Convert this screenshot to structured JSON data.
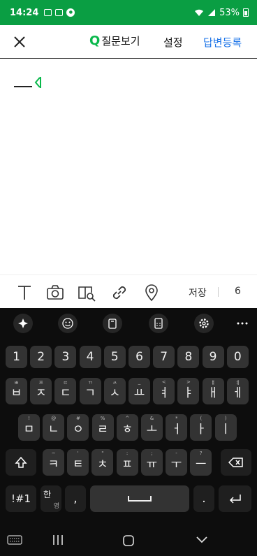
{
  "status": {
    "time": "14:24",
    "battery": "53%"
  },
  "header": {
    "close": "×",
    "q_icon": "Q",
    "q_label": "질문보기",
    "settings": "설정",
    "submit": "답변등록"
  },
  "toolbar": {
    "save": "저장",
    "count": "6"
  },
  "keyboard": {
    "number_row": [
      "1",
      "2",
      "3",
      "4",
      "5",
      "6",
      "7",
      "8",
      "9",
      "0"
    ],
    "row1": {
      "keys": [
        "ㅂ",
        "ㅈ",
        "ㄷ",
        "ㄱ",
        "ㅅ",
        "ㅛ",
        "ㅕ",
        "ㅑ",
        "ㅐ",
        "ㅔ"
      ],
      "hints": [
        "ㅃ",
        "ㅉ",
        "ㄸ",
        "ㄲ",
        "ㅆ",
        "_",
        "<",
        ">",
        "ㅒ",
        "ㅖ"
      ]
    },
    "row2": {
      "keys": [
        "ㅁ",
        "ㄴ",
        "ㅇ",
        "ㄹ",
        "ㅎ",
        "ㅗ",
        "ㅓ",
        "ㅏ",
        "ㅣ"
      ],
      "hints": [
        "!",
        "@",
        "#",
        "%",
        "^",
        "&",
        "*",
        "(",
        ")"
      ]
    },
    "row3": {
      "keys": [
        "ㅋ",
        "ㅌ",
        "ㅊ",
        "ㅍ",
        "ㅠ",
        "ㅜ",
        "ㅡ"
      ],
      "hints": [
        "~",
        "'",
        "\"",
        ":",
        ";",
        "-",
        "?"
      ]
    },
    "sym": "!#1",
    "lang_top": "한",
    "lang_bottom": "영",
    "comma": ",",
    "period": "."
  }
}
